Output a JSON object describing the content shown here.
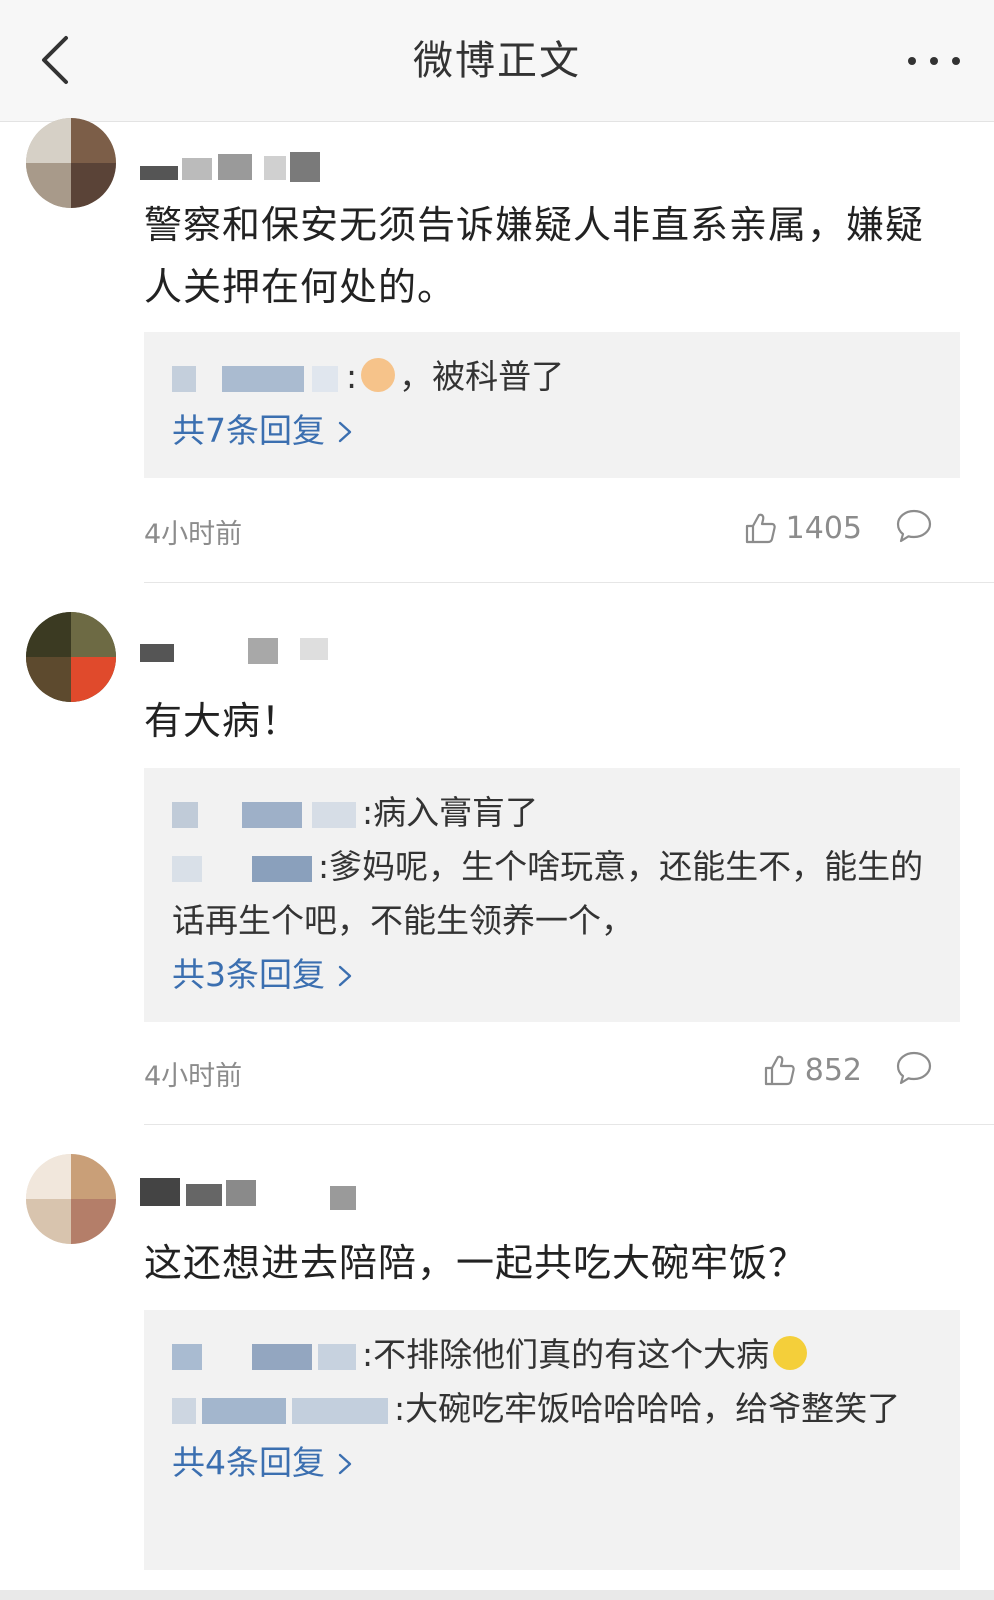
{
  "navbar": {
    "title": "微博正文",
    "back_icon": "chevron-left-icon",
    "more_icon": "more-dots-icon"
  },
  "comments": [
    {
      "text": "警察和保安无须告诉嫌疑人非直系亲属，嫌疑人关押在何处的。",
      "replies": [
        {
          "text_before": ":",
          "emoji": "ok-hand-emoji",
          "text": "，被科普了"
        }
      ],
      "more_replies": "共7条回复",
      "time": "4小时前",
      "likes": "1405"
    },
    {
      "text": "有大病！",
      "replies": [
        {
          "text": ":病入膏肓了"
        },
        {
          "text": ":爹妈呢，生个啥玩意，还能生不，能生的话再生个吧，不能生领养一个，"
        }
      ],
      "more_replies": "共3条回复",
      "time": "4小时前",
      "likes": "852"
    },
    {
      "text": "这还想进去陪陪，一起共吃大碗牢饭？",
      "replies": [
        {
          "text": ":不排除他们真的有这个大病",
          "emoji": "laugh-cry-emoji"
        },
        {
          "text": ":大碗吃牢饭哈哈哈哈，给爷整笑了"
        }
      ],
      "more_replies": "共4条回复",
      "time": null,
      "likes": null
    }
  ],
  "colors": {
    "link": "#3b6fb0",
    "meta_gray": "#8c8c8c",
    "reply_bg": "#f2f2f2",
    "navbar_bg": "#f7f7f7"
  },
  "icons": {
    "like": "thumbs-up-icon",
    "reply": "speech-bubble-icon",
    "chevron": "chevron-right-icon"
  }
}
